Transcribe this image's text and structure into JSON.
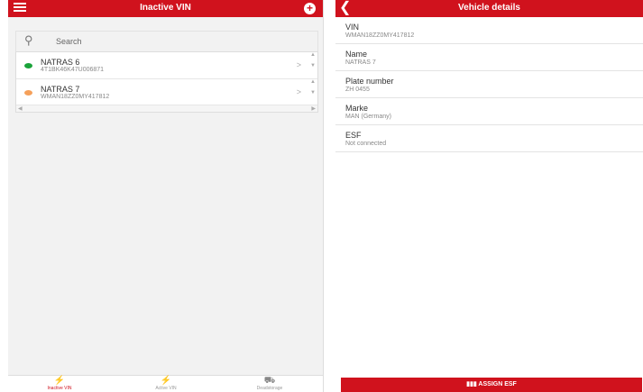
{
  "left": {
    "title": "Inactive VIN",
    "search_placeholder": "Search",
    "items": [
      {
        "name": "NATRAS 6",
        "vin": "4T1BK46K47U006871",
        "status_color": "#1aa33a"
      },
      {
        "name": "NATRAS 7",
        "vin": "WMAN18ZZ0MY417812",
        "status_color": "#f5a05a"
      }
    ],
    "nav": [
      {
        "label": "Inactive VIN",
        "icon": "plug-icon",
        "color": "#d0121d"
      },
      {
        "label": "Active VIN",
        "icon": "plug-icon",
        "color": "#888888"
      },
      {
        "label": "Deadstorage",
        "icon": "truck-icon",
        "color": "#888888"
      }
    ]
  },
  "right": {
    "title": "Vehicle details",
    "fields": [
      {
        "label": "VIN",
        "value": "WMAN18ZZ0MY417812"
      },
      {
        "label": "Name",
        "value": "NATRAS 7"
      },
      {
        "label": "Plate number",
        "value": "ZH 0455"
      },
      {
        "label": "Marke",
        "value": "MAN (Germany)"
      },
      {
        "label": "ESF",
        "value": "Not connected"
      }
    ],
    "assign_label": "ASSIGN ESF"
  },
  "colors": {
    "accent": "#d0121d"
  }
}
